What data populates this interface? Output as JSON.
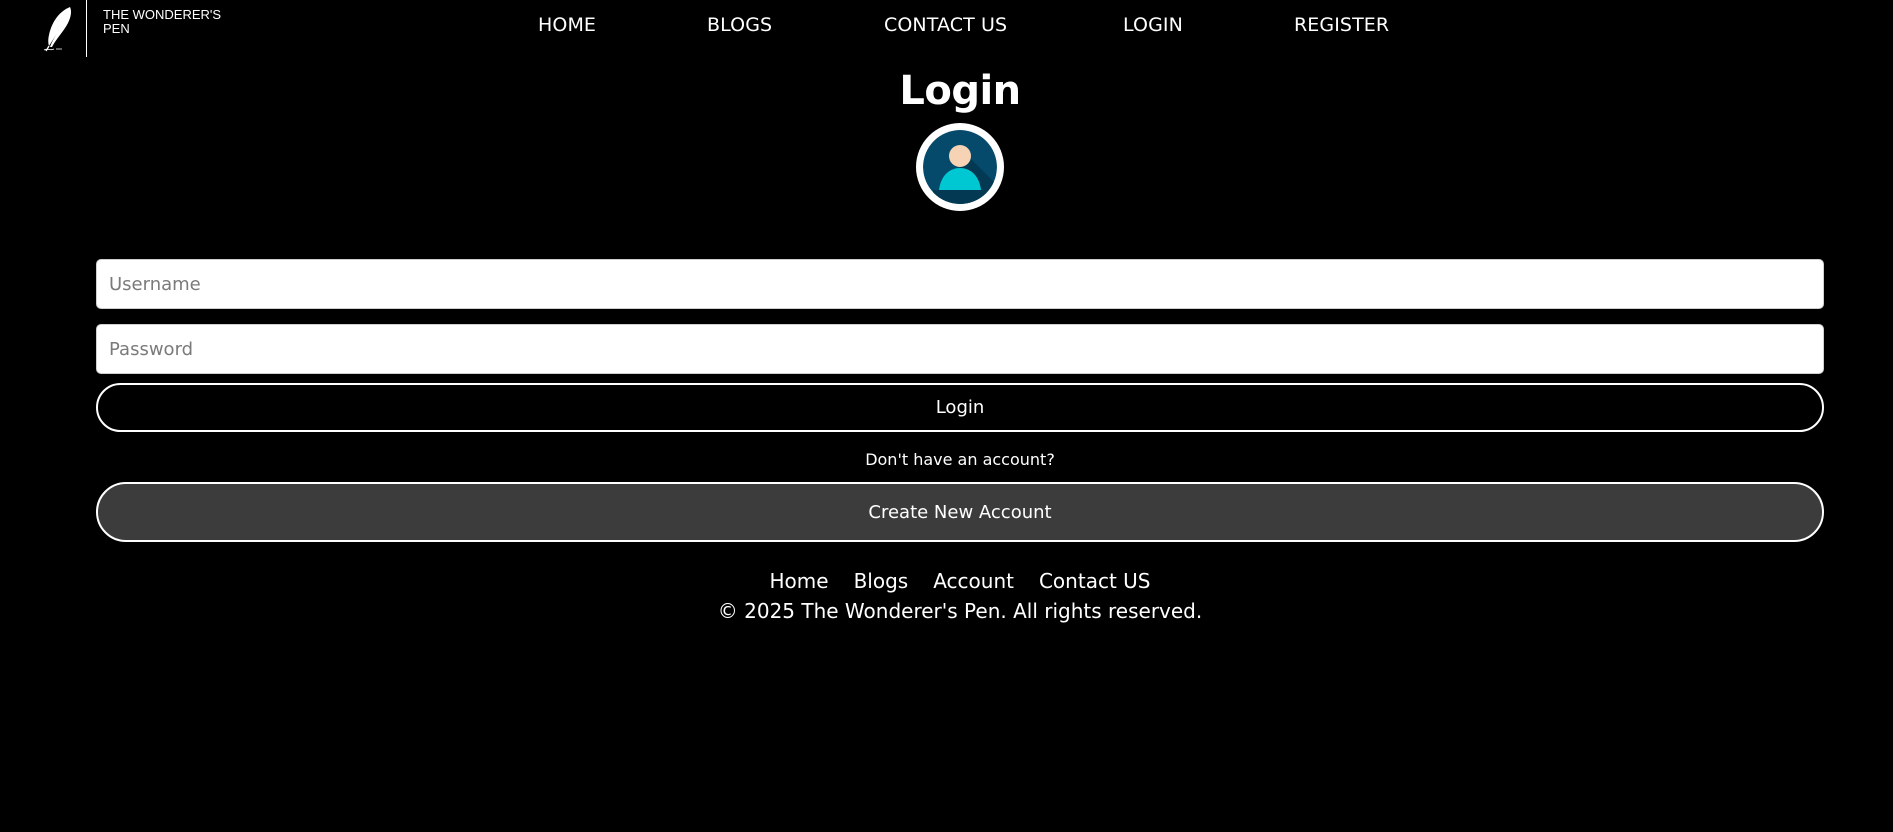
{
  "brand": {
    "name": "THE WONDERER'S PEN",
    "logo_icon": "feather-quill-icon"
  },
  "nav": {
    "items": [
      {
        "label": "HOME"
      },
      {
        "label": "BLOGS"
      },
      {
        "label": "CONTACT US"
      },
      {
        "label": "LOGIN"
      },
      {
        "label": "REGISTER"
      }
    ]
  },
  "main": {
    "title": "Login",
    "avatar_icon": "user-avatar-icon",
    "username": {
      "placeholder": "Username",
      "value": ""
    },
    "password": {
      "placeholder": "Password",
      "value": ""
    },
    "login_button": "Login",
    "no_account_text": "Don't have an account?",
    "create_account_button": "Create New Account"
  },
  "footer": {
    "links": [
      {
        "label": "Home"
      },
      {
        "label": "Blogs"
      },
      {
        "label": "Account"
      },
      {
        "label": "Contact US"
      }
    ],
    "copyright": "© 2025 The Wonderer's Pen. All rights reserved."
  },
  "colors": {
    "background": "#000000",
    "text": "#ffffff",
    "create_button_bg": "#3c3c3c",
    "avatar_circle": "#064a6b",
    "avatar_body": "#00c8d2",
    "avatar_face": "#f6d3b4"
  }
}
